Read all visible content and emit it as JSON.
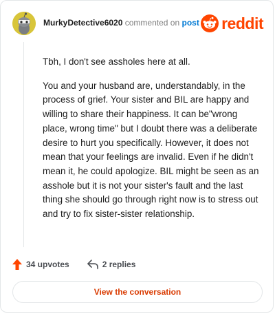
{
  "header": {
    "username": "MurkyDetective6020",
    "commented_text": "commented on",
    "post_link": "post",
    "brand": "reddit",
    "brand_color": "#ff4500",
    "avatar_icon": "snoo-avatar-icon",
    "logo_icon": "reddit-snoo-icon"
  },
  "comment": {
    "paragraphs": [
      "Tbh, I don't see assholes here at all.",
      "You and your husband are, understandably, in the process of grief. Your sister and BIL are happy and willing to share their happiness. It can be\"wrong place, wrong time\" but I doubt there was a deliberate desire to hurt you specifically. However, it does not mean that your feelings are invalid. Even if he didn't mean it, he could apologize. BIL might be seen as an asshole but it is not your sister's fault and the last thing she should go through right now is to stress out and try to fix sister-sister relationship."
    ]
  },
  "actions": {
    "upvotes": "34 upvotes",
    "upvote_icon": "upvote-arrow-icon",
    "replies": "2 replies",
    "reply_icon": "reply-arrow-icon",
    "upvote_color": "#ff4500"
  },
  "cta": {
    "label": "View the conversation",
    "color": "#d93a00"
  }
}
